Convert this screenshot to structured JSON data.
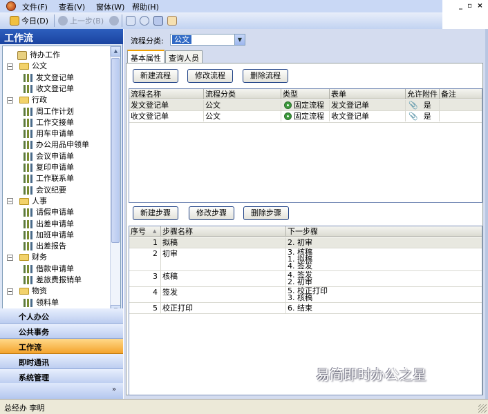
{
  "menubar": {
    "items": [
      {
        "label": "文件(F)"
      },
      {
        "label": "查看(V)"
      },
      {
        "label": "窗体(W)"
      },
      {
        "label": "帮助(H)"
      }
    ]
  },
  "toolbar": {
    "today_label": "今日(D)",
    "prev_label": "上一步(B)",
    "icons": [
      "today-icon",
      "back-icon",
      "forward-icon",
      "home-icon",
      "mail-icon",
      "share-icon",
      "edit-icon"
    ]
  },
  "left": {
    "title": "工作流",
    "tree": [
      {
        "label": "待办工作",
        "type": "task",
        "level": 0
      },
      {
        "label": "公文",
        "type": "folder",
        "level": 0,
        "expanded": true
      },
      {
        "label": "发文登记单",
        "type": "form",
        "level": 1
      },
      {
        "label": "收文登记单",
        "type": "form",
        "level": 1
      },
      {
        "label": "行政",
        "type": "folder",
        "level": 0,
        "expanded": true
      },
      {
        "label": "周工作计划",
        "type": "form",
        "level": 1
      },
      {
        "label": "工作交接单",
        "type": "form",
        "level": 1
      },
      {
        "label": "用车申请单",
        "type": "form",
        "level": 1
      },
      {
        "label": "办公用品申领单",
        "type": "form",
        "level": 1
      },
      {
        "label": "会议申请单",
        "type": "form",
        "level": 1
      },
      {
        "label": "复印申请单",
        "type": "form",
        "level": 1
      },
      {
        "label": "工作联系单",
        "type": "form",
        "level": 1
      },
      {
        "label": "会议纪要",
        "type": "form",
        "level": 1
      },
      {
        "label": "人事",
        "type": "folder",
        "level": 0,
        "expanded": true
      },
      {
        "label": "请假申请单",
        "type": "form",
        "level": 1
      },
      {
        "label": "出差申请单",
        "type": "form",
        "level": 1
      },
      {
        "label": "加班申请单",
        "type": "form",
        "level": 1
      },
      {
        "label": "出差报告",
        "type": "form",
        "level": 1
      },
      {
        "label": "财务",
        "type": "folder",
        "level": 0,
        "expanded": true
      },
      {
        "label": "借款申请单",
        "type": "form",
        "level": 1
      },
      {
        "label": "差旅费报销单",
        "type": "form",
        "level": 1
      },
      {
        "label": "物资",
        "type": "folder",
        "level": 0,
        "expanded": true
      },
      {
        "label": "领料单",
        "type": "form",
        "level": 1
      }
    ],
    "nav": [
      {
        "label": "个人办公",
        "active": false
      },
      {
        "label": "公共事务",
        "active": false
      },
      {
        "label": "工作流",
        "active": true
      },
      {
        "label": "即时通讯",
        "active": false
      },
      {
        "label": "系统管理",
        "active": false
      }
    ],
    "chevron": "»"
  },
  "main": {
    "category_label": "流程分类:",
    "category_value": "公文",
    "tabs": [
      {
        "label": "基本属性",
        "active": true
      },
      {
        "label": "查询人员",
        "active": false
      }
    ],
    "flow_buttons": {
      "new": "新建流程",
      "edit": "修改流程",
      "delete": "删除流程"
    },
    "flow_columns": [
      "流程名称",
      "流程分类",
      "类型",
      "表单",
      "允许附件",
      "备注"
    ],
    "flows": [
      {
        "name": "发文登记单",
        "category": "公文",
        "type": "固定流程",
        "form": "发文登记单",
        "attach": "是",
        "note": ""
      },
      {
        "name": "收文登记单",
        "category": "公文",
        "type": "固定流程",
        "form": "收文登记单",
        "attach": "是",
        "note": ""
      }
    ],
    "step_buttons": {
      "new": "新建步骤",
      "edit": "修改步骤",
      "delete": "删除步骤"
    },
    "step_columns": [
      "序号",
      "步骤名称",
      "下一步骤"
    ],
    "sort_indicator": "▲",
    "steps": [
      {
        "no": "1",
        "name": "拟稿",
        "next": [
          "2. 初审"
        ]
      },
      {
        "no": "2",
        "name": "初审",
        "next": [
          "3. 核稿",
          "1. 拟稿",
          "4. 签发"
        ]
      },
      {
        "no": "3",
        "name": "核稿",
        "next": [
          "4. 签发",
          "2. 初审"
        ]
      },
      {
        "no": "4",
        "name": "签发",
        "next": [
          "5. 校正打印",
          "3. 核稿"
        ]
      },
      {
        "no": "5",
        "name": "校正打印",
        "next": [
          "6. 结束"
        ]
      }
    ]
  },
  "watermark": "易简即时办公之星",
  "status": {
    "text": "总经办 李明"
  }
}
